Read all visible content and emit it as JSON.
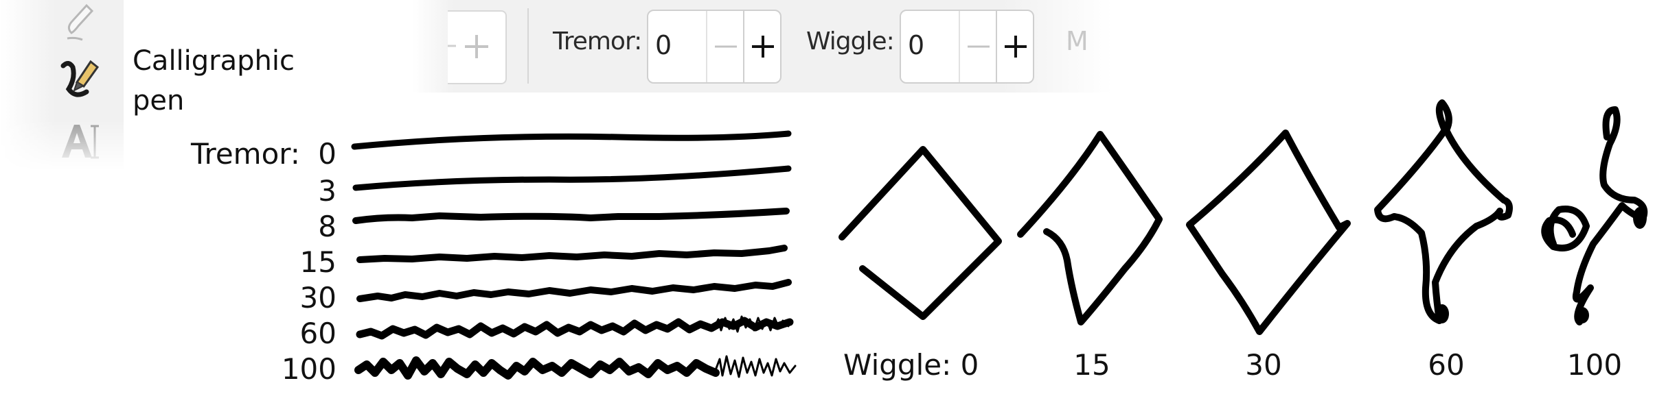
{
  "tool": {
    "label": "Calligraphic pen",
    "icons": [
      "pencil-icon",
      "calligraphic-pen-icon",
      "text-tool-icon"
    ]
  },
  "toolbar": {
    "tremor": {
      "label": "Tremor:",
      "value": "0"
    },
    "wiggle": {
      "label": "Wiggle:",
      "value": "0"
    },
    "more_label": "M"
  },
  "samples": {
    "tremor_title": "Tremor:",
    "tremor_values": [
      "0",
      "3",
      "8",
      "15",
      "30",
      "60",
      "100"
    ],
    "wiggle_labels": [
      "Wiggle: 0",
      "15",
      "30",
      "60",
      "100"
    ]
  },
  "colors": {
    "ink": "#000000",
    "toolbar_bg": "#f1f1f1",
    "muted": "#c8c8c8"
  }
}
